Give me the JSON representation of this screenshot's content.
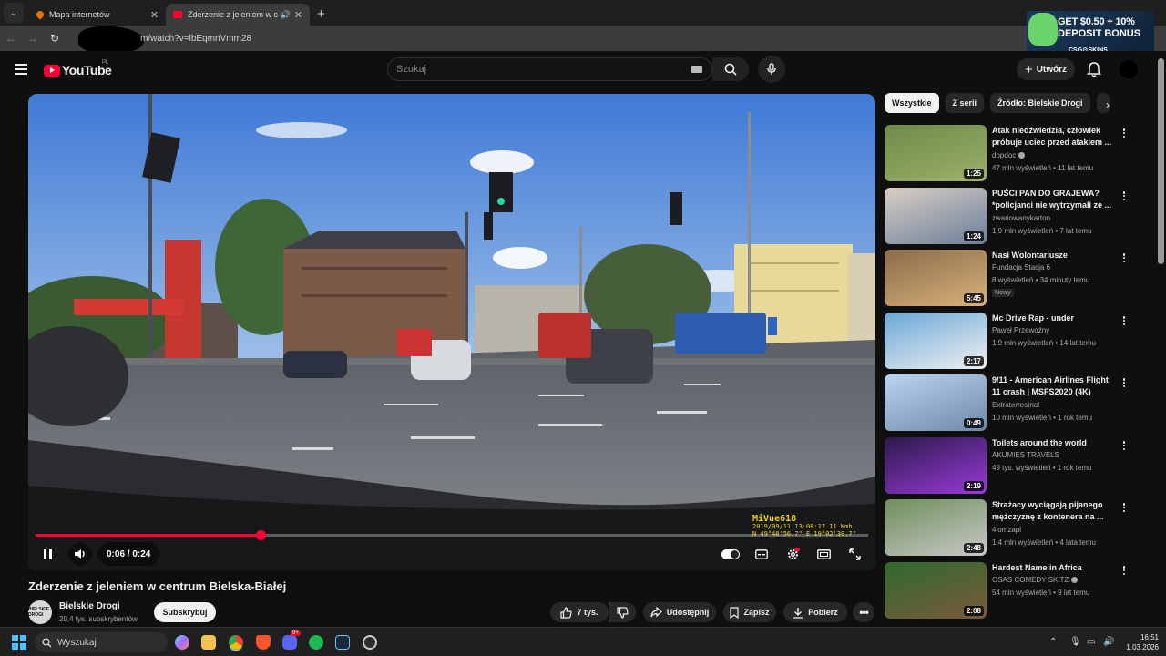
{
  "browser": {
    "tabs": [
      {
        "label": "Mapa internetów",
        "active": false
      },
      {
        "label": "Zderzenie z jeleniem w cent",
        "active": true
      }
    ],
    "url": "m/watch?v=lbEqmnVmm28"
  },
  "ad": {
    "line1": "GET $0.50 + 10%",
    "line2": "DEPOSIT BONUS",
    "line3": "CSG⚙SKINS"
  },
  "header": {
    "logo": "YouTube",
    "country": "PL",
    "search_placeholder": "Szukaj",
    "create_label": "Utwórz"
  },
  "player": {
    "current_time": "0:06",
    "duration": "0:24",
    "time_display": "0:06 / 0:24",
    "progress_fraction": 0.27,
    "osd": {
      "brand": "MiVue618",
      "line1": "2019/09/11  13:08:17  11 Kmh",
      "line2": "N 49°48'56.7\"  E  19°02'39.7\""
    }
  },
  "video": {
    "title": "Zderzenie z jeleniem w centrum Bielska-Białej",
    "channel": "Bielskie Drogi",
    "subscribers": "20,4 tys. subskrybentów",
    "avatar_text": "BIELSKIE DROGI",
    "subscribe_label": "Subskrybuj",
    "likes": "7 tys.",
    "share_label": "Udostępnij",
    "save_label": "Zapisz",
    "download_label": "Pobierz"
  },
  "sidebar": {
    "chips": [
      "Wszystkie",
      "Z serii",
      "Źródło: Bielskie Drogi"
    ],
    "recommendations": [
      {
        "title": "Atak niedźwiedzia, człowiek próbuje uciec przed atakiem ...",
        "channel": "dopdoc",
        "verified": true,
        "meta": "47 mln wyświetleń • 11 lat temu",
        "duration": "1:25",
        "badge": ""
      },
      {
        "title": "PUŚCI PAN DO GRAJEWA? *policjanci nie wytrzymali ze ...",
        "channel": "zwariowanykarton",
        "verified": false,
        "meta": "1,9 mln wyświetleń • 7 lat temu",
        "duration": "1:24",
        "badge": ""
      },
      {
        "title": "Nasi Wolontariusze",
        "channel": "Fundacja Stacja 6",
        "verified": false,
        "meta": "8 wyświetleń • 34 minuty temu",
        "duration": "5:45",
        "badge": "Nowy"
      },
      {
        "title": "Mc Drive Rap - under",
        "channel": "Paweł Przewoźny",
        "verified": false,
        "meta": "1,9 mln wyświetleń • 14 lat temu",
        "duration": "2:17",
        "badge": ""
      },
      {
        "title": "9/11 - American Airlines Flight 11 crash | MSFS2020 (4K)",
        "channel": "Extraterrestrial",
        "verified": false,
        "meta": "10 mln wyświetleń • 1 rok temu",
        "duration": "0:49",
        "badge": ""
      },
      {
        "title": "Toilets around the world",
        "channel": "AKUMIES TRAVELS",
        "verified": false,
        "meta": "49 tys. wyświetleń • 1 rok temu",
        "duration": "2:19",
        "badge": ""
      },
      {
        "title": "Strażacy wyciągają pijanego mężczyznę z kontenera na ...",
        "channel": "4lomzapl",
        "verified": false,
        "meta": "1,4 mln wyświetleń • 4 lata temu",
        "duration": "2:48",
        "badge": ""
      },
      {
        "title": "Hardest Name in Africa",
        "channel": "OSAS COMEDY SKITZ",
        "verified": true,
        "meta": "54 mln wyświetleń • 9 lat temu",
        "duration": "2:08",
        "badge": ""
      }
    ]
  },
  "taskbar": {
    "search_placeholder": "Wyszukaj",
    "time": "16:51",
    "date": "1.03.2026",
    "discord_badge": "9+"
  },
  "colors": {
    "accent": "#ff0033",
    "osd": "#f1d21a",
    "windows": "#4cc2ff"
  }
}
